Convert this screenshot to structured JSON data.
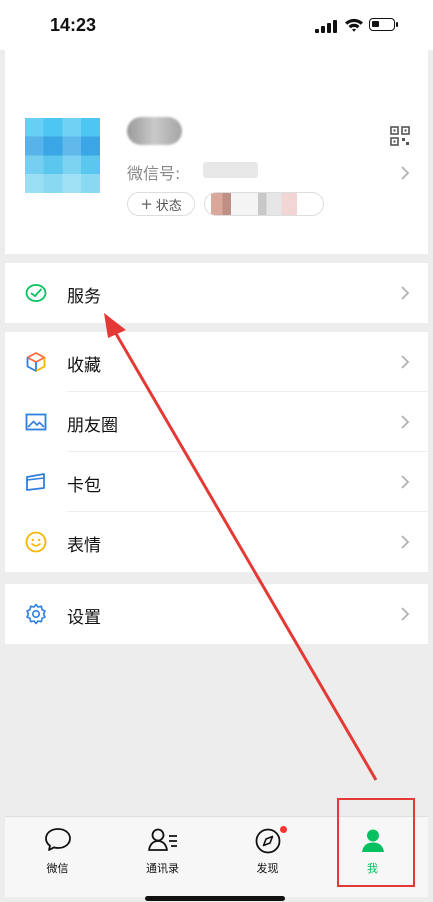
{
  "status_bar": {
    "time": "14:23"
  },
  "profile": {
    "wechat_id_label": "微信号:",
    "status_button": "状态"
  },
  "menu": {
    "service": "服务",
    "favorites": "收藏",
    "moments": "朋友圈",
    "cards": "卡包",
    "stickers": "表情",
    "settings": "设置"
  },
  "tab_bar": {
    "chats": "微信",
    "contacts": "通讯录",
    "discover": "发现",
    "me": "我"
  },
  "colors": {
    "accent": "#07c160",
    "annotation": "#e53935",
    "badge": "#f43530"
  }
}
